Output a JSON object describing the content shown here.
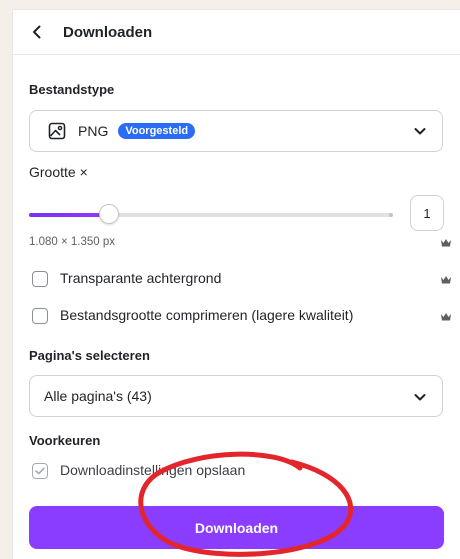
{
  "header": {
    "title": "Downloaden"
  },
  "file_type": {
    "label": "Bestandstype",
    "value": "PNG",
    "badge": "Voorgesteld"
  },
  "size": {
    "label": "Grootte ×",
    "multiplier": "1",
    "dimensions": "1.080 × 1.350 px",
    "slider_value_fraction": 0.22
  },
  "options": {
    "transparent_bg": "Transparante achtergrond",
    "compress": "Bestandsgrootte comprimeren (lagere kwaliteit)"
  },
  "pages": {
    "label": "Pagina's selecteren",
    "value": "Alle pagina's (43)"
  },
  "preferences": {
    "label": "Voorkeuren",
    "save_settings": "Downloadinstellingen opslaan"
  },
  "download_button": "Downloaden",
  "colors": {
    "accent": "#8b3dff",
    "badge": "#2b6cf6",
    "annotation_circle": "#e3262b"
  },
  "icons": [
    "back-chevron-icon",
    "image-file-icon",
    "chevron-down-icon",
    "crown-icon",
    "checkmark-icon"
  ]
}
